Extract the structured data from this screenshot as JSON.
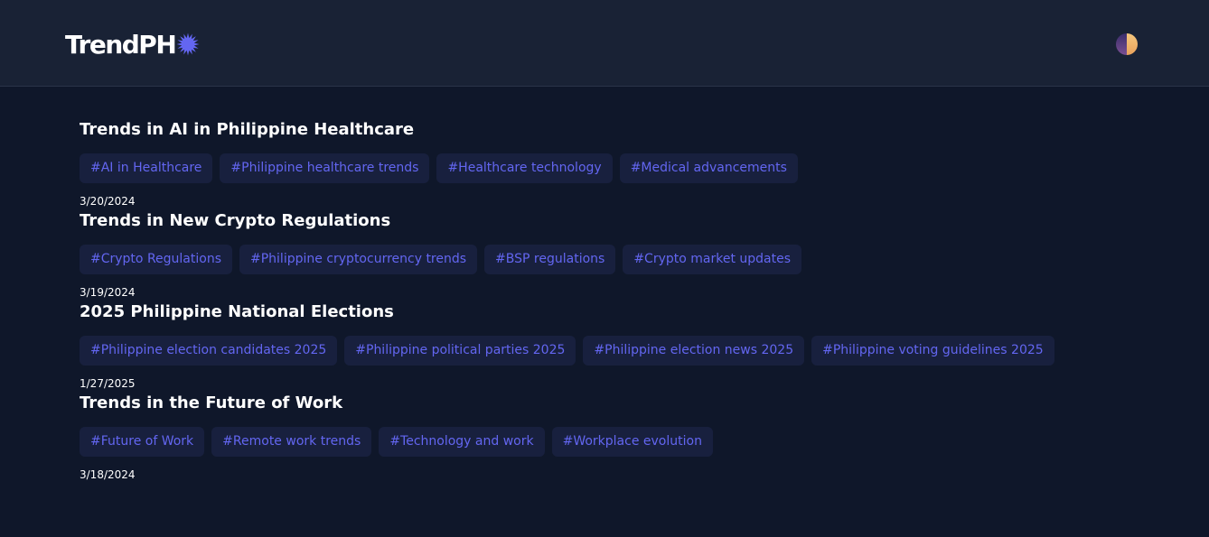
{
  "header": {
    "logo_text": "TrendPH",
    "logo_icon": "starburst-icon",
    "theme_toggle_icon": "half-moon-theme-icon",
    "accent_color": "#6366f1"
  },
  "trends": [
    {
      "date": "",
      "title": "Trends in AI in Philippine Healthcare",
      "tags": [
        "#AI in Healthcare",
        "#Philippine healthcare trends",
        "#Healthcare technology",
        "#Medical advancements"
      ]
    },
    {
      "date": "3/20/2024",
      "title": "Trends in New Crypto Regulations",
      "tags": [
        "#Crypto Regulations",
        "#Philippine cryptocurrency trends",
        "#BSP regulations",
        "#Crypto market updates"
      ]
    },
    {
      "date": "3/19/2024",
      "title": "2025 Philippine National Elections",
      "tags": [
        "#Philippine election candidates 2025",
        "#Philippine political parties 2025",
        "#Philippine election news 2025",
        "#Philippine voting guidelines 2025"
      ]
    },
    {
      "date": "1/27/2025",
      "title": "Trends in the Future of Work",
      "tags": [
        "#Future of Work",
        "#Remote work trends",
        "#Technology and work",
        "#Workplace evolution"
      ]
    },
    {
      "date": "3/18/2024",
      "title": "",
      "tags": []
    }
  ]
}
